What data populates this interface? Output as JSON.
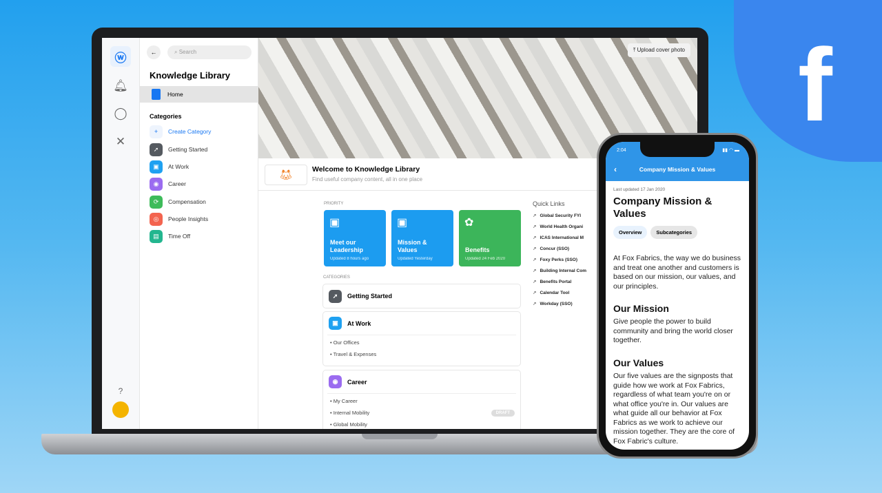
{
  "brand": {
    "logo": "f",
    "color": "#3a86ee"
  },
  "rail": {
    "icons": [
      "workplace-logo",
      "bell-icon",
      "chat-icon",
      "tools-icon",
      "help-icon",
      "avatar"
    ]
  },
  "sidebar": {
    "search_placeholder": "Search",
    "title": "Knowledge Library",
    "home": "Home",
    "categories_heading": "Categories",
    "create": "Create Category",
    "items": [
      {
        "label": "Getting Started",
        "color": "#555a60"
      },
      {
        "label": "At Work",
        "color": "#1fa1f1"
      },
      {
        "label": "Career",
        "color": "#9b6cf0"
      },
      {
        "label": "Compensation",
        "color": "#3ebb5a"
      },
      {
        "label": "People Insights",
        "color": "#f3644f"
      },
      {
        "label": "Time Off",
        "color": "#23b68f"
      }
    ]
  },
  "main": {
    "upload": "Upload cover photo",
    "welcome_title": "Welcome to Knowledge Library",
    "welcome_sub": "Find useful company content, all in one place",
    "priority_label": "PRIORITY",
    "priority": [
      {
        "title": "Meet our Leadership",
        "updated": "Updated 8 hours ago",
        "color": "#1c9cf0"
      },
      {
        "title": "Mission & Values",
        "updated": "Updated Yesterday",
        "color": "#1c9cf0"
      },
      {
        "title": "Benefits",
        "updated": "Updated 24 Feb 2020",
        "color": "#3cb55a"
      }
    ],
    "categories_label": "CATEGORIES",
    "categories": [
      {
        "title": "Getting Started"
      },
      {
        "title": "At Work",
        "items": [
          "Our Offices",
          "Travel & Expenses"
        ]
      },
      {
        "title": "Career",
        "items": [
          "My Career",
          "Internal Mobility",
          "Global Mobility"
        ],
        "badge": "DRAFT"
      }
    ],
    "quick_links_title": "Quick Links",
    "quick_links": [
      "Global Security FYI",
      "World Health Organi",
      "ICAS International M",
      "Concur (SSO)",
      "Foxy Perks (SSO)",
      "Building Internal Com",
      "Benefits Portal",
      "Calendar Tool",
      "Workday (SSO)"
    ]
  },
  "phone": {
    "time": "2:04",
    "nav_title": "Company Mission & Values",
    "updated": "Last updated 17 Jan 2020",
    "title": "Company Mission & Values",
    "tabs": [
      "Overview",
      "Subcategories"
    ],
    "intro": "At Fox Fabrics, the way we do business and treat one another and customers is based on our mission, our values, and our principles.",
    "mission_heading": "Our Mission",
    "mission": "Give people the power to build community and bring the world closer together.",
    "values_heading": "Our Values",
    "values": "Our five values are the signposts that guide how we work at Fox Fabrics, regardless of what team you're on or what office you're in. Our values are what guide all our behavior at Fox Fabrics as we work to achieve our mission together. They are the core of Fox Fabric's culture."
  }
}
